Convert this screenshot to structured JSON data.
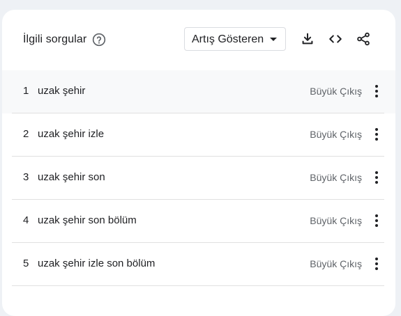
{
  "header": {
    "title": "İlgili sorgular",
    "help_icon": "help-circle-icon",
    "filter": {
      "selected": "Artış Gösteren",
      "caret_icon": "caret-down-icon"
    },
    "tools": [
      "download-icon",
      "embed-code-icon",
      "share-icon"
    ]
  },
  "rows": [
    {
      "rank": "1",
      "query": "uzak şehir",
      "value": "Büyük Çıkış"
    },
    {
      "rank": "2",
      "query": "uzak şehir izle",
      "value": "Büyük Çıkış"
    },
    {
      "rank": "3",
      "query": "uzak şehir son",
      "value": "Büyük Çıkış"
    },
    {
      "rank": "4",
      "query": "uzak şehir son bölüm",
      "value": "Büyük Çıkış"
    },
    {
      "rank": "5",
      "query": "uzak şehir izle son bölüm",
      "value": "Büyük Çıkış"
    }
  ],
  "colors": {
    "page_background": "#eef1f5",
    "card_background": "#ffffff",
    "highlight_row": "#f8f9fa",
    "text_primary": "#202124",
    "text_secondary": "#5f6368",
    "divider": "#e0e0e0"
  }
}
